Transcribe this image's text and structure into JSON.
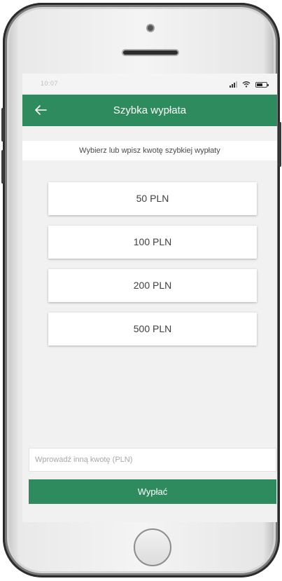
{
  "status_bar": {
    "time": "10:07",
    "icons": [
      "signal-icon",
      "wifi-icon",
      "battery-icon"
    ]
  },
  "header": {
    "back_icon": "arrow-left-icon",
    "title": "Szybka wypłata"
  },
  "instruction": "Wybierz lub wpisz kwotę szybkiej wypłaty",
  "amounts": [
    {
      "label": "50 PLN"
    },
    {
      "label": "100 PLN"
    },
    {
      "label": "200 PLN"
    },
    {
      "label": "500 PLN"
    }
  ],
  "custom_amount": {
    "placeholder": "Wprowadź inną kwotę (PLN)",
    "value": ""
  },
  "withdraw_button": {
    "label": "Wypłać"
  },
  "colors": {
    "brand_green": "#2e8b5e",
    "screen_background": "#f1f1f1"
  }
}
